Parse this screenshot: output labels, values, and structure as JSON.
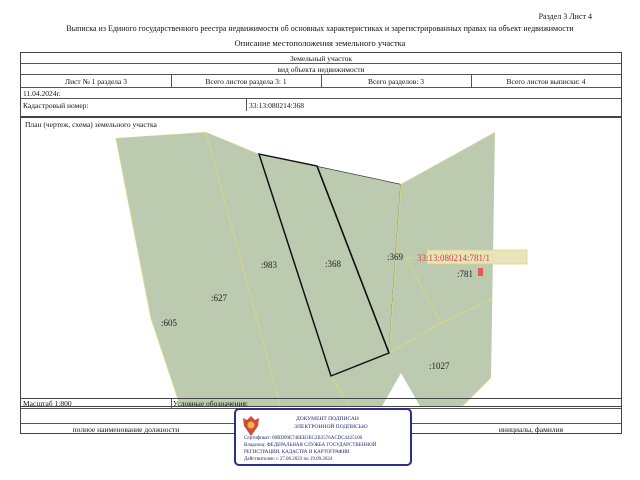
{
  "header": {
    "section_sheet": "Раздел 3   Лист 4",
    "title": "Выписка из Единого государственного реестра недвижимости об основных характеристиках и зарегистрированных правах на объект недвижимости",
    "subtitle": "Описание местоположения земельного участка"
  },
  "object": {
    "type": "Земельный участок",
    "kind": "вид объекта недвижимости"
  },
  "sheet_info": {
    "sheet": "Лист № 1 раздела 3",
    "total_sheets_section": "Всего листов раздела 3: 1",
    "total_sections": "Всего разделов: 3",
    "total_sheets_extract": "Всего листов выписки: 4"
  },
  "date": "11.04.2024г.",
  "cadastral": {
    "label": "Кадастровый номер:",
    "value": "33:13:080214:368"
  },
  "plan": {
    "label": "План (чертеж, схема) земельного участка",
    "parcels": [
      {
        "label": ":605"
      },
      {
        "label": ":627"
      },
      {
        "label": ":983"
      },
      {
        "label": ":368"
      },
      {
        "label": ":369"
      },
      {
        "label": ":781"
      },
      {
        "label": ":1027"
      }
    ],
    "highlight_label": "33:13:080214:781/1",
    "colors": {
      "parcel_fill": "#bccbb0",
      "parcel_edge": "#d6d58a",
      "subject_edge": "#222222",
      "highlight": "#e85a5a"
    }
  },
  "footer": {
    "scale": "Масштаб 1:800",
    "legend": "Условные обозначения:",
    "position_label": "полное наименование должности",
    "name_label": "инициалы, фамилия"
  },
  "stamp": {
    "line1": "ДОКУМЕНТ ПОДПИСАН",
    "line2": "ЭЛЕКТРОННОЙ ПОДПИСЬЮ",
    "cert": "Сертификат: 00BD09E748EB3EC2B3576ACDC4425100",
    "owner": "Владелец: ФЕДЕРАЛЬНАЯ СЛУЖБА ГОСУДАРСТВЕННОЙ",
    "owner2": "РЕГИСТРАЦИИ, КАДАСТРА И КАРТОГРАФИИ",
    "valid": "Действителен: с 27.06.2023 по 19.09.2024",
    "border_color": "#2a2f8a"
  }
}
